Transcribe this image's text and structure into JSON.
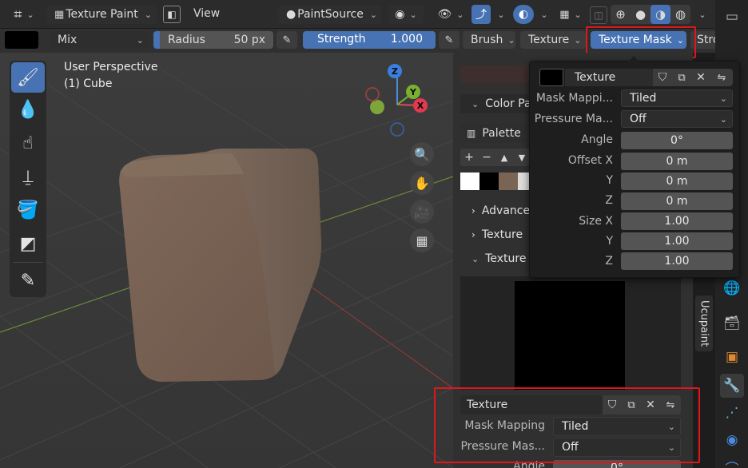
{
  "header": {
    "mode_label": "Texture Paint",
    "view_label": "View",
    "paint_source": "PaintSource",
    "colors": {
      "accent": "#4772b3",
      "highlight": "#e0161b"
    }
  },
  "toolbar": {
    "blend_mode": "Mix",
    "radius_label": "Radius",
    "radius_value": "50 px",
    "strength_label": "Strength",
    "strength_value": "1.000",
    "strength_fraction": 1.0,
    "brush_label": "Brush",
    "texture_label": "Texture",
    "texture_mask_label": "Texture Mask",
    "stroke_label": "Stro"
  },
  "viewport": {
    "perspective": "User Perspective",
    "object": "(1) Cube",
    "gizmo": {
      "z": "Z",
      "y": "Y",
      "x": "X"
    }
  },
  "properties": {
    "color_palette": "Color Pa",
    "palette_name": "Palette",
    "advanced": "Advance",
    "texture_collapsed": "Texture",
    "texture_expanded": "Texture",
    "texture_slot_name": "Texture",
    "mask_mapping_label": "Mask Mapping",
    "mask_mapping_value": "Tiled",
    "pressure_mask_label": "Pressure Mas...",
    "pressure_mask_value": "Off",
    "angle_label_partial": "Angle",
    "angle_value_partial": "0°",
    "ucupaint_tab": "Ucupaint"
  },
  "popup": {
    "texture_name": "Texture",
    "mask_mapping_label": "Mask Mappi...",
    "mask_mapping_value": "Tiled",
    "pressure_mask_label": "Pressure Ma...",
    "pressure_mask_value": "Off",
    "angle_label": "Angle",
    "angle_value": "0°",
    "offset_x_label": "Offset X",
    "offset_x_value": "0 m",
    "offset_y_label": "Y",
    "offset_y_value": "0 m",
    "offset_z_label": "Z",
    "offset_z_value": "0 m",
    "size_x_label": "Size X",
    "size_x_value": "1.00",
    "size_y_label": "Y",
    "size_y_value": "1.00",
    "size_z_label": "Z",
    "size_z_value": "1.00"
  }
}
